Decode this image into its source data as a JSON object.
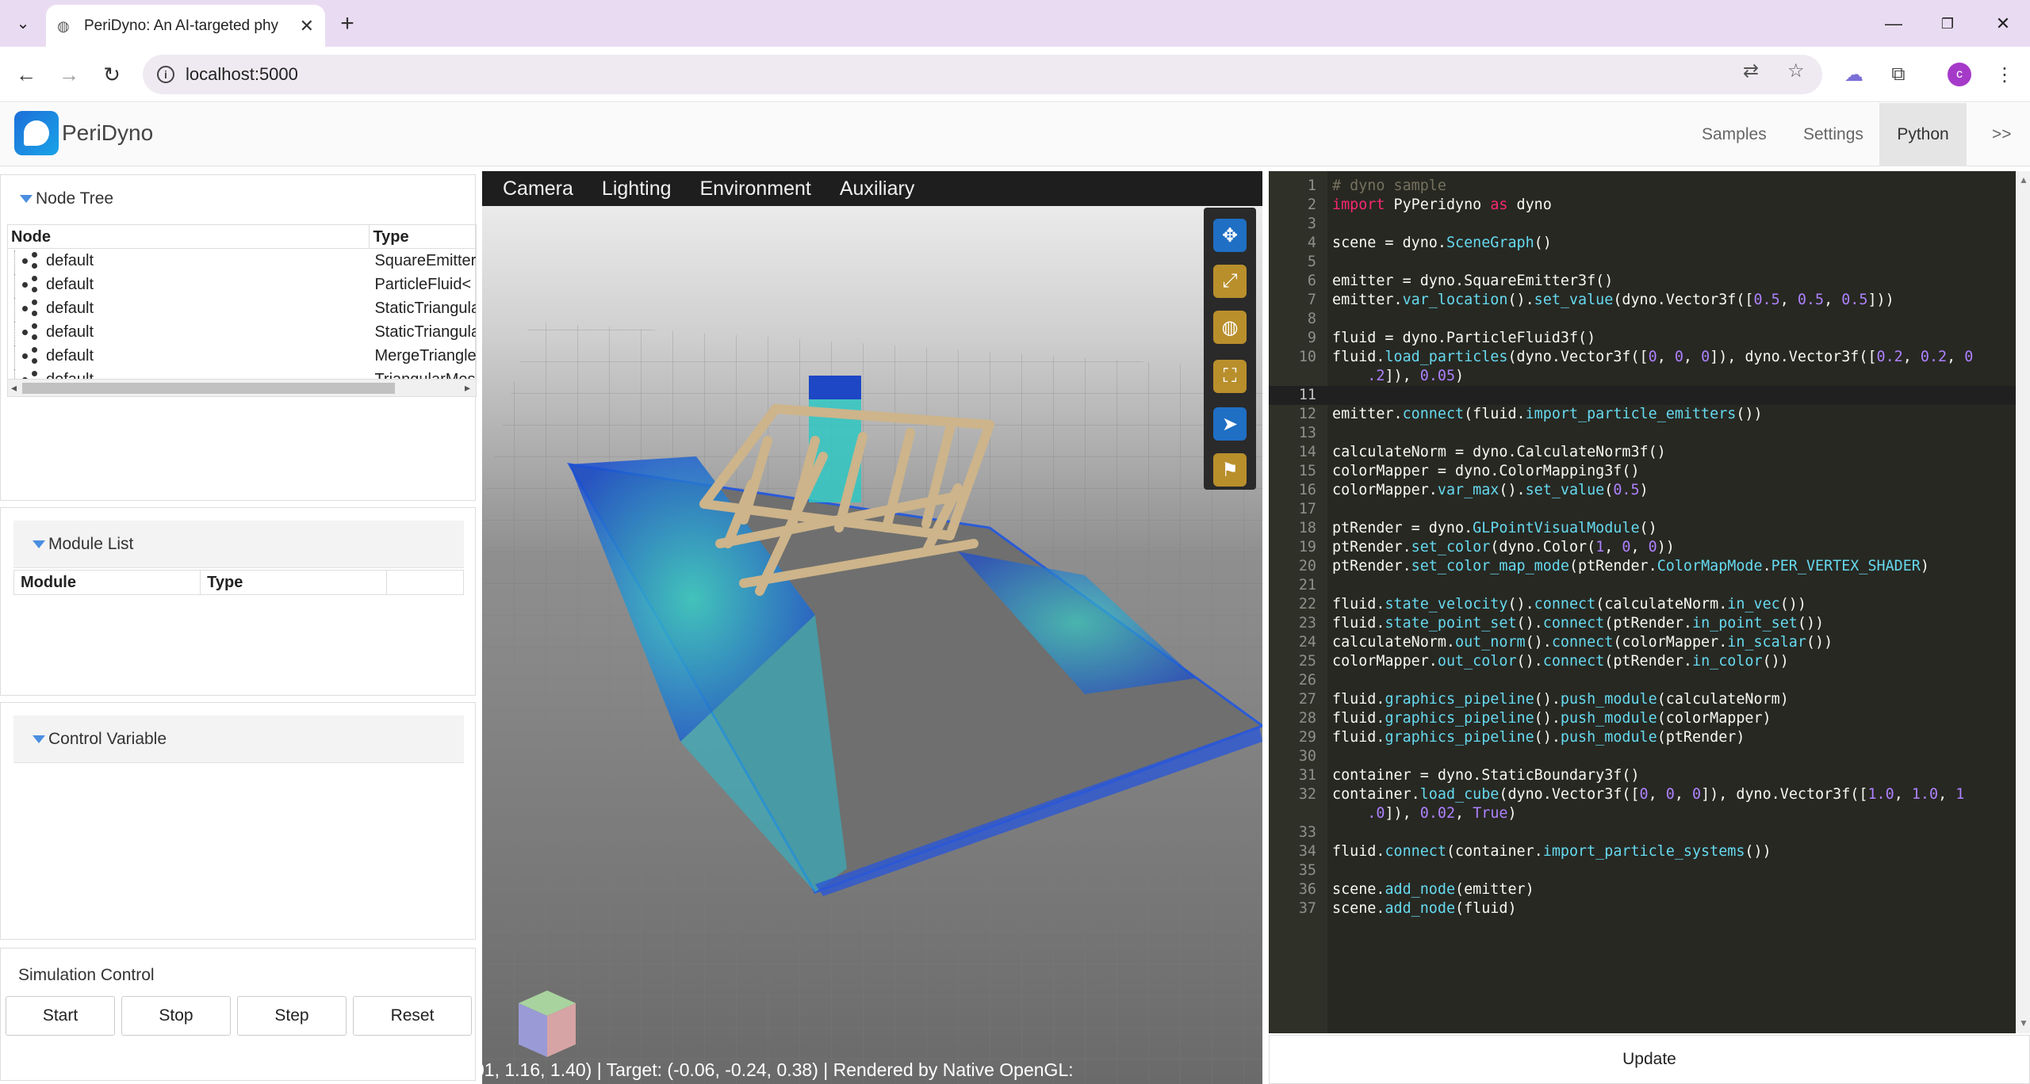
{
  "browser": {
    "tab_title": "PeriDyno: An AI-targeted phy",
    "url": "localhost:5000"
  },
  "app": {
    "brand": "PeriDyno",
    "nav": [
      "Samples",
      "Settings",
      "Python",
      ">>"
    ],
    "active_nav": "Python"
  },
  "node_tree": {
    "title": "Node Tree",
    "columns": [
      "Node",
      "Type"
    ],
    "rows": [
      {
        "node": "default",
        "type": "SquareEmitter"
      },
      {
        "node": "default",
        "type": "ParticleFluid<"
      },
      {
        "node": "default",
        "type": "StaticTriangula"
      },
      {
        "node": "default",
        "type": "StaticTriangula"
      },
      {
        "node": "default",
        "type": "MergeTriangle"
      },
      {
        "node": "default",
        "type": "TriangularMes"
      }
    ]
  },
  "module_list": {
    "title": "Module List",
    "columns": [
      "Module",
      "Type"
    ]
  },
  "control_variable": {
    "title": "Control Variable"
  },
  "simulation_control": {
    "title": "Simulation Control",
    "buttons": [
      "Start",
      "Stop",
      "Step",
      "Reset"
    ]
  },
  "viewport": {
    "menu": [
      "Camera",
      "Lighting",
      "Environment",
      "Auxiliary"
    ],
    "status": "01, 1.16, 1.40) | Target: (-0.06, -0.24, 0.38) | Rendered by Native OpenGL:",
    "tools": [
      {
        "icon": "move-icon",
        "color": "blue"
      },
      {
        "icon": "scale-icon",
        "color": "gold"
      },
      {
        "icon": "globe-icon",
        "color": "gold"
      },
      {
        "icon": "fit-view-icon",
        "color": "gold"
      },
      {
        "icon": "navigate-icon",
        "color": "blue"
      },
      {
        "icon": "flag-icon",
        "color": "gold"
      }
    ]
  },
  "editor": {
    "current_line": 11,
    "lines": [
      "# dyno sample",
      "import PyPeridyno as dyno",
      "",
      "scene = dyno.SceneGraph()",
      "",
      "emitter = dyno.SquareEmitter3f()",
      "emitter.var_location().set_value(dyno.Vector3f([0.5, 0.5, 0.5]))",
      "",
      "fluid = dyno.ParticleFluid3f()",
      "fluid.load_particles(dyno.Vector3f([0, 0, 0]), dyno.Vector3f([0.2, 0.2, 0\n    .2]), 0.05)",
      "",
      "emitter.connect(fluid.import_particle_emitters())",
      "",
      "calculateNorm = dyno.CalculateNorm3f()",
      "colorMapper = dyno.ColorMapping3f()",
      "colorMapper.var_max().set_value(0.5)",
      "",
      "ptRender = dyno.GLPointVisualModule()",
      "ptRender.set_color(dyno.Color(1, 0, 0))",
      "ptRender.set_color_map_mode(ptRender.ColorMapMode.PER_VERTEX_SHADER)",
      "",
      "fluid.state_velocity().connect(calculateNorm.in_vec())",
      "fluid.state_point_set().connect(ptRender.in_point_set())",
      "calculateNorm.out_norm().connect(colorMapper.in_scalar())",
      "colorMapper.out_color().connect(ptRender.in_color())",
      "",
      "fluid.graphics_pipeline().push_module(calculateNorm)",
      "fluid.graphics_pipeline().push_module(colorMapper)",
      "fluid.graphics_pipeline().push_module(ptRender)",
      "",
      "container = dyno.StaticBoundary3f()",
      "container.load_cube(dyno.Vector3f([0, 0, 0]), dyno.Vector3f([1.0, 1.0, 1\n    .0]), 0.02, True)",
      "",
      "fluid.connect(container.import_particle_systems())",
      "",
      "scene.add_node(emitter)",
      "scene.add_node(fluid)"
    ],
    "update_label": "Update"
  }
}
